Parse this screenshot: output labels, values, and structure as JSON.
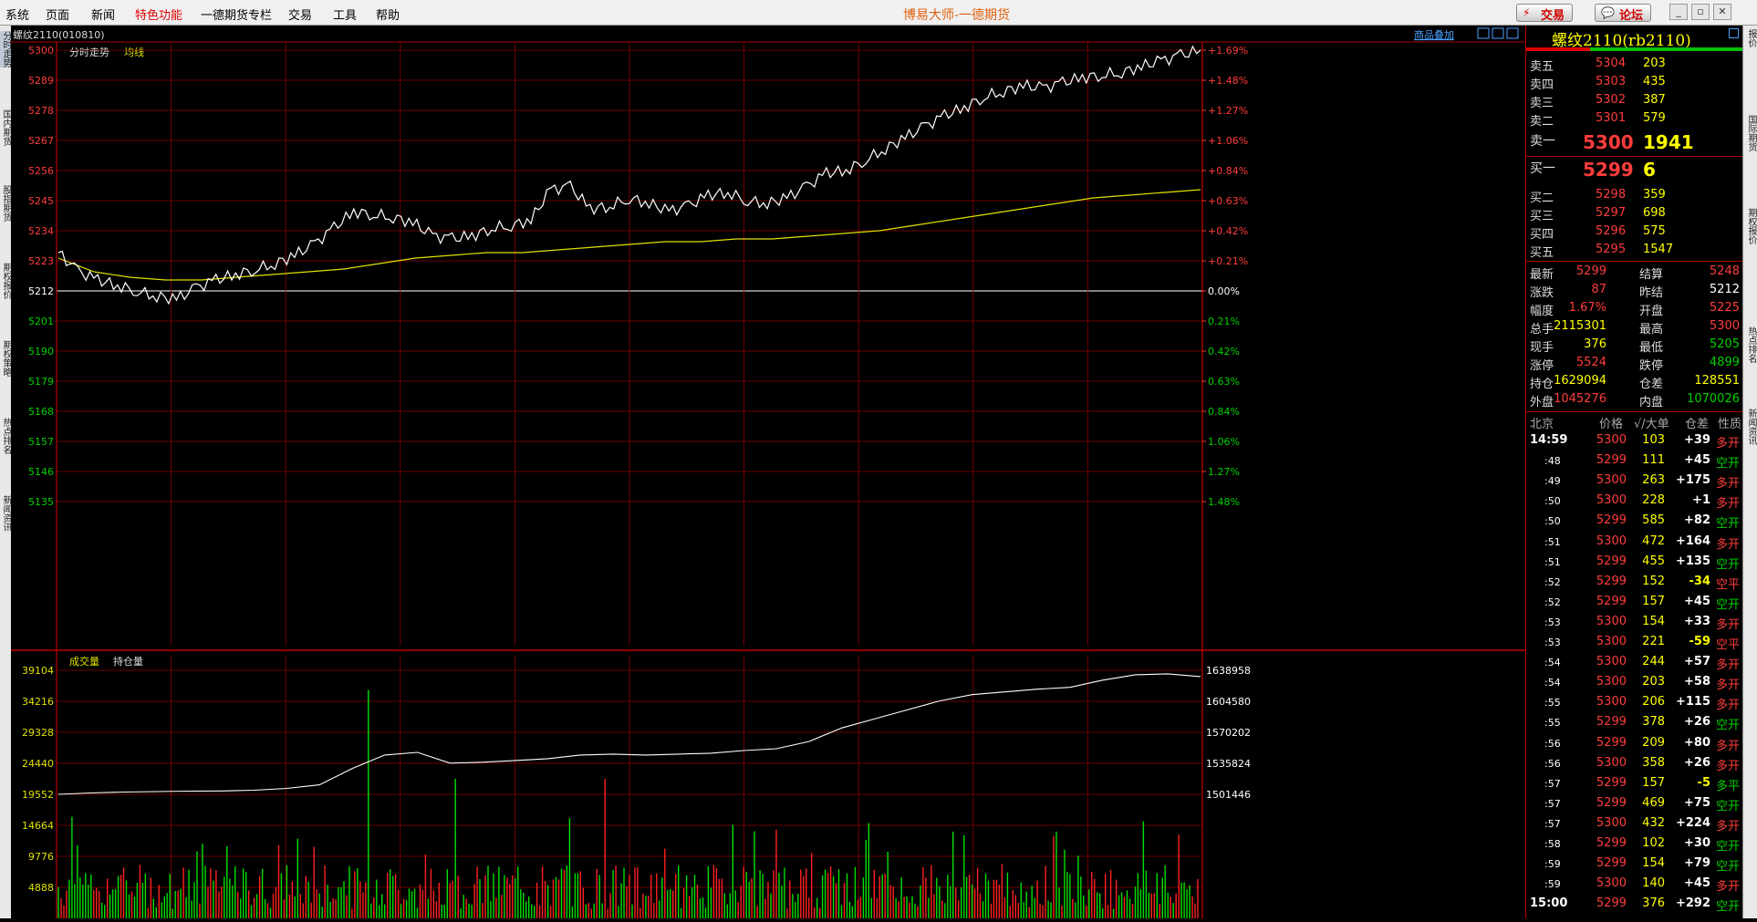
{
  "menu": [
    "系统",
    "页面",
    "新闻",
    "特色功能",
    "一德期货专栏",
    "交易",
    "工具",
    "帮助"
  ],
  "active_menu": "特色功能",
  "app_title": "博易大师-一德期货",
  "buttons": {
    "trade": "交易",
    "forum": "论坛"
  },
  "left_tabs": [
    "分时走势",
    "国内期货",
    "股指期货",
    "期权报价",
    "期权策略",
    "热点排名",
    "新闻资讯"
  ],
  "right_tabs": [
    "报价",
    "国际期货",
    "期权报价",
    "热点排名",
    "新闻资讯"
  ],
  "chart": {
    "header": "螺纹2110(010810)",
    "overlay": "商品叠加",
    "legend": {
      "intraday": "分时走势",
      "average": "均线"
    },
    "vol_legend": {
      "volume": "成交量",
      "oi": "持仓量"
    },
    "colors": {
      "price": "#ffffff",
      "avg": "#e0e000",
      "vol_up": "#ff2020",
      "vol_down": "#00e000",
      "grid": "#8a0000"
    }
  },
  "chart_data": {
    "type": "line",
    "price_ticks": [
      "5300",
      "5289",
      "5278",
      "5267",
      "5256",
      "5245",
      "5234",
      "5223",
      "5212",
      "5201",
      "5190",
      "5179",
      "5168",
      "5157",
      "5146",
      "5135"
    ],
    "pct_ticks": [
      "+1.69%",
      "+1.48%",
      "+1.27%",
      "+1.06%",
      "+0.84%",
      "+0.63%",
      "+0.42%",
      "+0.21%",
      "0.00%",
      "0.21%",
      "0.42%",
      "0.63%",
      "0.84%",
      "1.06%",
      "1.27%",
      "1.48%"
    ],
    "ylim": [
      5129,
      5300
    ],
    "prev_settle": 5212,
    "price_series": [
      5226,
      5219,
      5216,
      5214,
      5212,
      5210,
      5209,
      5213,
      5216,
      5218,
      5220,
      5222,
      5225,
      5229,
      5235,
      5241,
      5240,
      5239,
      5237,
      5232,
      5231,
      5232,
      5235,
      5236,
      5238,
      5249,
      5250,
      5242,
      5243,
      5246,
      5244,
      5241,
      5243,
      5247,
      5248,
      5245,
      5244,
      5246,
      5250,
      5255,
      5256,
      5260,
      5264,
      5268,
      5272,
      5276,
      5279,
      5283,
      5285,
      5287,
      5286,
      5288,
      5290,
      5291,
      5292,
      5294,
      5296,
      5298,
      5300
    ],
    "avg_series": [
      5224,
      5219,
      5217,
      5216,
      5216,
      5217,
      5218,
      5219,
      5220,
      5222,
      5224,
      5225,
      5226,
      5226,
      5227,
      5228,
      5229,
      5230,
      5230,
      5231,
      5231,
      5232,
      5233,
      5234,
      5236,
      5238,
      5240,
      5242,
      5244,
      5246,
      5247,
      5248,
      5249
    ],
    "vol_ticks": [
      "39104",
      "34216",
      "29328",
      "24440",
      "19552",
      "14664",
      "9776",
      "4888"
    ],
    "oi_ticks": [
      "1638958",
      "1604580",
      "1570202",
      "1535824",
      "1501446"
    ],
    "oi_series": [
      1501446,
      1503000,
      1504000,
      1504500,
      1505000,
      1505200,
      1506000,
      1508000,
      1512000,
      1530000,
      1545000,
      1548000,
      1536000,
      1537000,
      1539000,
      1541000,
      1545000,
      1546000,
      1545000,
      1546000,
      1547000,
      1550000,
      1552000,
      1560000,
      1575000,
      1585000,
      1595000,
      1605000,
      1612000,
      1615000,
      1618000,
      1620000,
      1628000,
      1634000,
      1635000,
      1632000
    ]
  },
  "quote": {
    "title": "螺纹2110(rb2110)",
    "asks": [
      {
        "label": "卖五",
        "price": "5304",
        "vol": "203"
      },
      {
        "label": "卖四",
        "price": "5303",
        "vol": "435"
      },
      {
        "label": "卖三",
        "price": "5302",
        "vol": "387"
      },
      {
        "label": "卖二",
        "price": "5301",
        "vol": "579"
      },
      {
        "label": "卖一",
        "price": "5300",
        "vol": "1941"
      }
    ],
    "bids": [
      {
        "label": "买一",
        "price": "5299",
        "vol": "6"
      },
      {
        "label": "买二",
        "price": "5298",
        "vol": "359"
      },
      {
        "label": "买三",
        "price": "5297",
        "vol": "698"
      },
      {
        "label": "买四",
        "price": "5296",
        "vol": "575"
      },
      {
        "label": "买五",
        "price": "5295",
        "vol": "1547"
      }
    ],
    "stats": [
      {
        "l1": "最新",
        "v1": "5299",
        "c1": "red",
        "l2": "结算",
        "v2": "5248",
        "c2": "red"
      },
      {
        "l1": "涨跌",
        "v1": "87",
        "c1": "red",
        "l2": "昨结",
        "v2": "5212",
        "c2": "white"
      },
      {
        "l1": "幅度",
        "v1": "1.67%",
        "c1": "red",
        "l2": "开盘",
        "v2": "5225",
        "c2": "red"
      },
      {
        "l1": "总手",
        "v1": "2115301",
        "c1": "yellow",
        "l2": "最高",
        "v2": "5300",
        "c2": "red"
      },
      {
        "l1": "现手",
        "v1": "376",
        "c1": "yellow",
        "l2": "最低",
        "v2": "5205",
        "c2": "green"
      },
      {
        "l1": "涨停",
        "v1": "5524",
        "c1": "red",
        "l2": "跌停",
        "v2": "4899",
        "c2": "green"
      },
      {
        "l1": "持仓",
        "v1": "1629094",
        "c1": "yellow",
        "l2": "仓差",
        "v2": "128551",
        "c2": "yellow"
      },
      {
        "l1": "外盘",
        "v1": "1045276",
        "c1": "red",
        "l2": "内盘",
        "v2": "1070026",
        "c2": "green"
      }
    ],
    "trade_header": {
      "time": "北京",
      "price": "价格",
      "vol": "√/大单",
      "oi": "仓差",
      "nature": "性质"
    },
    "trades": [
      {
        "t": "14:59",
        "p": "5300",
        "v": "103",
        "oi": "+39",
        "n": "多开",
        "pc": "red",
        "nc": "red"
      },
      {
        "t": ":48",
        "p": "5299",
        "v": "111",
        "oi": "+45",
        "n": "空开",
        "pc": "red",
        "nc": "green"
      },
      {
        "t": ":49",
        "p": "5300",
        "v": "263",
        "oi": "+175",
        "n": "多开",
        "pc": "red",
        "nc": "red"
      },
      {
        "t": ":50",
        "p": "5300",
        "v": "228",
        "oi": "+1",
        "n": "多开",
        "pc": "red",
        "nc": "red"
      },
      {
        "t": ":50",
        "p": "5299",
        "v": "585",
        "oi": "+82",
        "n": "空开",
        "pc": "red",
        "nc": "green"
      },
      {
        "t": ":51",
        "p": "5300",
        "v": "472",
        "oi": "+164",
        "n": "多开",
        "pc": "red",
        "nc": "red"
      },
      {
        "t": ":51",
        "p": "5299",
        "v": "455",
        "oi": "+135",
        "n": "空开",
        "pc": "red",
        "nc": "green"
      },
      {
        "t": ":52",
        "p": "5299",
        "v": "152",
        "oi": "-34",
        "n": "空平",
        "pc": "red",
        "nc": "red"
      },
      {
        "t": ":52",
        "p": "5299",
        "v": "157",
        "oi": "+45",
        "n": "空开",
        "pc": "red",
        "nc": "green"
      },
      {
        "t": ":53",
        "p": "5300",
        "v": "154",
        "oi": "+33",
        "n": "多开",
        "pc": "red",
        "nc": "red"
      },
      {
        "t": ":53",
        "p": "5300",
        "v": "221",
        "oi": "-59",
        "n": "空平",
        "pc": "red",
        "nc": "red"
      },
      {
        "t": ":54",
        "p": "5300",
        "v": "244",
        "oi": "+57",
        "n": "多开",
        "pc": "red",
        "nc": "red"
      },
      {
        "t": ":54",
        "p": "5300",
        "v": "203",
        "oi": "+58",
        "n": "多开",
        "pc": "red",
        "nc": "red"
      },
      {
        "t": ":55",
        "p": "5300",
        "v": "206",
        "oi": "+115",
        "n": "多开",
        "pc": "red",
        "nc": "red"
      },
      {
        "t": ":55",
        "p": "5299",
        "v": "378",
        "oi": "+26",
        "n": "空开",
        "pc": "red",
        "nc": "green"
      },
      {
        "t": ":56",
        "p": "5299",
        "v": "209",
        "oi": "+80",
        "n": "多开",
        "pc": "red",
        "nc": "red"
      },
      {
        "t": ":56",
        "p": "5300",
        "v": "358",
        "oi": "+26",
        "n": "多开",
        "pc": "red",
        "nc": "red"
      },
      {
        "t": ":57",
        "p": "5299",
        "v": "157",
        "oi": "-5",
        "n": "多平",
        "pc": "red",
        "nc": "green"
      },
      {
        "t": ":57",
        "p": "5299",
        "v": "469",
        "oi": "+75",
        "n": "空开",
        "pc": "red",
        "nc": "green"
      },
      {
        "t": ":57",
        "p": "5300",
        "v": "432",
        "oi": "+224",
        "n": "多开",
        "pc": "red",
        "nc": "red"
      },
      {
        "t": ":58",
        "p": "5299",
        "v": "102",
        "oi": "+30",
        "n": "空开",
        "pc": "red",
        "nc": "green"
      },
      {
        "t": ":59",
        "p": "5299",
        "v": "154",
        "oi": "+79",
        "n": "空开",
        "pc": "red",
        "nc": "green"
      },
      {
        "t": ":59",
        "p": "5300",
        "v": "140",
        "oi": "+45",
        "n": "多开",
        "pc": "red",
        "nc": "red"
      },
      {
        "t": "15:00",
        "p": "5299",
        "v": "376",
        "oi": "+292",
        "n": "空开",
        "pc": "red",
        "nc": "green"
      }
    ]
  }
}
